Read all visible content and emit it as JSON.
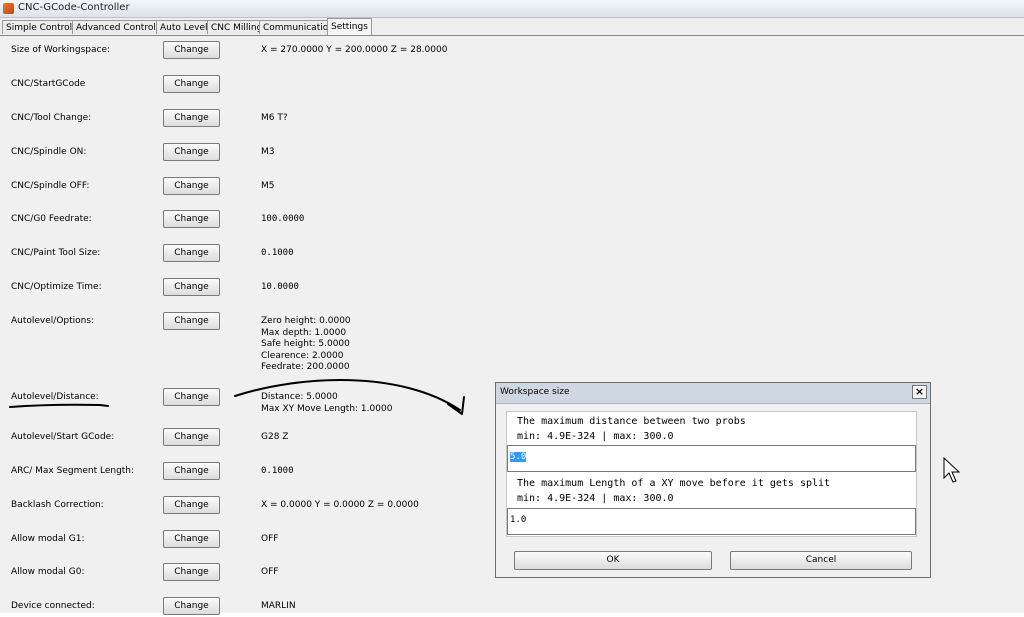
{
  "window": {
    "title": "CNC-GCode-Controller"
  },
  "tabs": [
    {
      "label": "Simple Controls"
    },
    {
      "label": "Advanced Controls"
    },
    {
      "label": "Auto Level"
    },
    {
      "label": "CNC Milling"
    },
    {
      "label": "Communication"
    },
    {
      "label": "Settings"
    }
  ],
  "button_label": "Change",
  "settings": [
    {
      "label": "Size of Workingspace:",
      "value": "X = 270.0000   Y = 200.0000   Z = 28.0000"
    },
    {
      "label": "CNC/StartGCode",
      "value": ""
    },
    {
      "label": "CNC/Tool Change:",
      "value": "M6 T?"
    },
    {
      "label": "CNC/Spindle ON:",
      "value": "M3"
    },
    {
      "label": "CNC/Spindle OFF:",
      "value": "M5"
    },
    {
      "label": "CNC/G0 Feedrate:",
      "value": "100.0000"
    },
    {
      "label": "CNC/Paint Tool Size:",
      "value": "0.1000"
    },
    {
      "label": "CNC/Optimize Time:",
      "value": "10.0000"
    },
    {
      "label": "Autolevel/Options:",
      "value": "Zero height: 0.0000\nMax depth: 1.0000\nSafe height: 5.0000\nClearence: 2.0000\nFeedrate: 200.0000"
    },
    {
      "label": "Autolevel/Distance:",
      "value": "Distance: 5.0000\nMax XY Move Length: 1.0000"
    },
    {
      "label": "Autolevel/Start GCode:",
      "value": "G28 Z"
    },
    {
      "label": "ARC/ Max Segment Length:",
      "value": "0.1000"
    },
    {
      "label": "Backlash Correction:",
      "value": "X = 0.0000   Y = 0.0000   Z = 0.0000"
    },
    {
      "label": "Allow modal G1:",
      "value": "OFF"
    },
    {
      "label": "Allow modal G0:",
      "value": "OFF"
    },
    {
      "label": "Device connected:",
      "value": "MARLIN"
    }
  ],
  "dialog": {
    "title": "Workspace size",
    "close": "×",
    "distance_desc": "The maximum distance between two probs",
    "distance_range": "min: 4.9E-324 | max: 300.0",
    "distance_value": "5.0",
    "length_desc": "The maximum Length of a XY move before it gets split",
    "length_range": "min: 4.9E-324 | max: 300.0",
    "length_value": "1.0",
    "ok_label": "OK",
    "cancel_label": "Cancel"
  }
}
